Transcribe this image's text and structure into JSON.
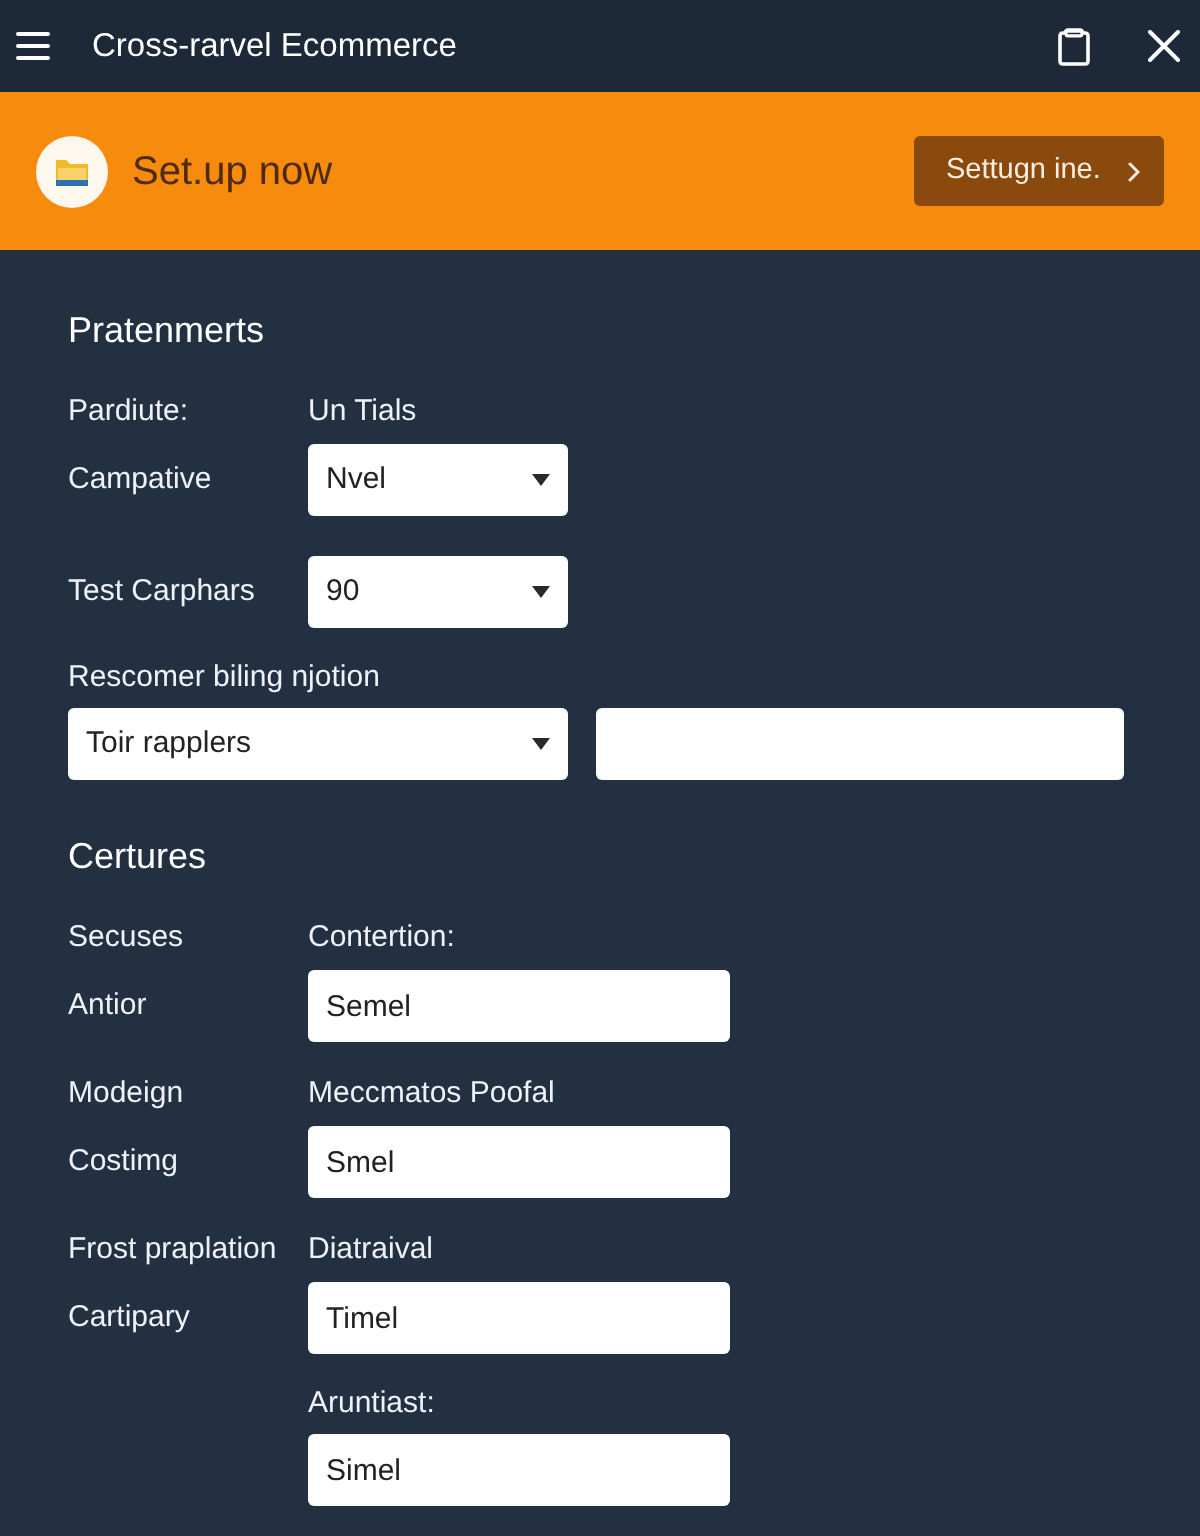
{
  "window": {
    "title": "Cross-rarvel Ecommerce"
  },
  "banner": {
    "text": "Set.up now",
    "button": "Settugn ine."
  },
  "sections": [
    {
      "title": "Pratenmerts",
      "rows": [
        {
          "kind": "pair",
          "label": "Pardiute:",
          "field": {
            "kind": "text",
            "text": "Un Tials"
          }
        },
        {
          "kind": "pair",
          "label": "Campative",
          "field": {
            "kind": "select",
            "value": "Nvel"
          }
        },
        {
          "kind": "pair",
          "label": "Test Carphars",
          "field": {
            "kind": "select",
            "value": "90"
          }
        },
        {
          "kind": "caption",
          "text": "Rescomer biling njotion"
        },
        {
          "kind": "fields",
          "fields": [
            {
              "kind": "select",
              "value": "Toir rapplers"
            },
            {
              "kind": "input"
            }
          ]
        }
      ]
    },
    {
      "title": "Certures",
      "rows": [
        {
          "kind": "pair",
          "label": "Secuses",
          "field": {
            "kind": "text",
            "text": "Contertion:"
          }
        },
        {
          "kind": "pair",
          "label": "Antior",
          "field": {
            "kind": "input",
            "value": "Semel"
          }
        },
        {
          "kind": "pair",
          "label": "Modeign",
          "field": {
            "kind": "text",
            "text": "Meccmatos Poofal"
          }
        },
        {
          "kind": "pair",
          "label": "Costimg",
          "field": {
            "kind": "input",
            "value": "Smel"
          }
        },
        {
          "kind": "pair",
          "label": "Frost praplation",
          "field": {
            "kind": "text",
            "text": "Diatraival"
          }
        },
        {
          "kind": "pair",
          "label": "Cartipary",
          "field": {
            "kind": "input",
            "value": "Timel"
          }
        },
        {
          "kind": "pair",
          "field": {
            "kind": "text",
            "text": "Aruntiast:"
          }
        },
        {
          "kind": "pair",
          "field": {
            "kind": "input",
            "value": "Simel"
          }
        }
      ]
    }
  ]
}
